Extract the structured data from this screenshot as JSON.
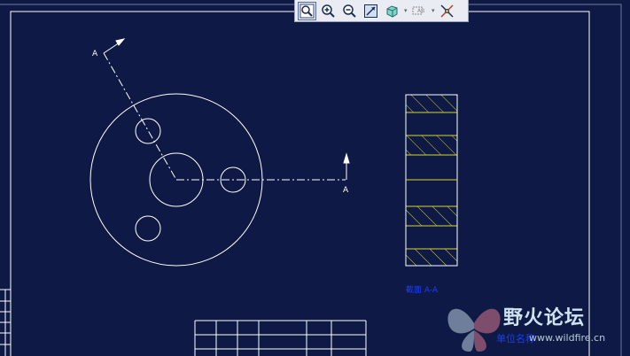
{
  "drawing": {
    "section_mark_left": "A",
    "section_mark_right": "A",
    "section_caption": "截面 A-A",
    "overlay_caption": "单位名称"
  },
  "toolbar": {
    "items": [
      {
        "name": "zoom-window",
        "label": "Zoom Window"
      },
      {
        "name": "zoom-in",
        "label": "Zoom In"
      },
      {
        "name": "zoom-out",
        "label": "Zoom Out"
      },
      {
        "name": "zoom-extents",
        "label": "Zoom Extents"
      },
      {
        "name": "3d-view",
        "label": "3D View"
      },
      {
        "name": "text-style",
        "label": "AB"
      },
      {
        "name": "measure",
        "label": "Measure"
      }
    ]
  },
  "watermark": {
    "title": "野火论坛",
    "url": "www.wildfire.cn"
  },
  "colors": {
    "background": "#0e1a45",
    "lines": "#ffffff",
    "hatch": "#d6d430",
    "caption": "#1a3cff"
  }
}
